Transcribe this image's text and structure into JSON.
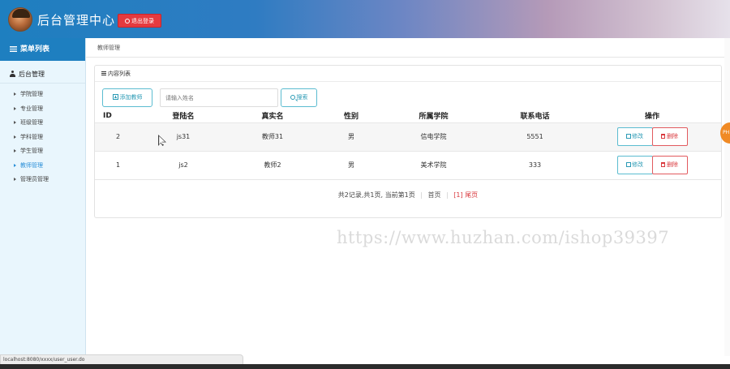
{
  "header": {
    "app_title": "后台管理中心",
    "logout_label": "退出登录"
  },
  "sidebar": {
    "menu_title": "菜单列表",
    "group_title": "后台管理",
    "items": [
      {
        "label": "学院管理"
      },
      {
        "label": "专业管理"
      },
      {
        "label": "班级管理"
      },
      {
        "label": "学科管理"
      },
      {
        "label": "学生管理"
      },
      {
        "label": "教师管理"
      },
      {
        "label": "管理员管理"
      }
    ],
    "active_item": "教师管理"
  },
  "breadcrumb": "教师管理",
  "panel": {
    "title": "内容列表",
    "add_button": "添加教师",
    "search_placeholder": "请输入姓名",
    "search_button": "搜索"
  },
  "table": {
    "headers": [
      "ID",
      "登陆名",
      "真实名",
      "性别",
      "所属学院",
      "联系电话",
      "操作"
    ],
    "rows": [
      {
        "id": "2",
        "login": "js31",
        "real_name": "教师31",
        "gender": "男",
        "college": "信电学院",
        "phone": "5551",
        "edit": "修改",
        "delete": "删除"
      },
      {
        "id": "1",
        "login": "js2",
        "real_name": "教师2",
        "gender": "男",
        "college": "美术学院",
        "phone": "333",
        "edit": "修改",
        "delete": "删除"
      }
    ]
  },
  "pager": {
    "summary": "共2记录,共1页, 当前第1页",
    "first": "首页",
    "current": "[1]",
    "last": "尾页"
  },
  "watermark": "https://www.huzhan.com/ishop39397",
  "status_url": "localhost:8080/xxxx/user_user.do",
  "float_tab": "PH",
  "colors": {
    "header_start": "#1e7fc0",
    "danger": "#e53a3f",
    "info": "#2a9ab5",
    "sidebar_bg": "#e9f6fd"
  }
}
